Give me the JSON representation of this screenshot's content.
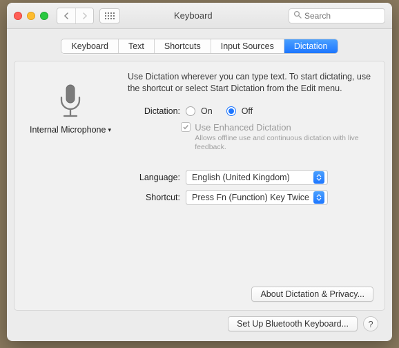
{
  "window": {
    "title": "Keyboard",
    "search_placeholder": "Search"
  },
  "tabs": {
    "keyboard": "Keyboard",
    "text": "Text",
    "shortcuts": "Shortcuts",
    "input_sources": "Input Sources",
    "dictation": "Dictation"
  },
  "mic": {
    "label": "Internal Microphone"
  },
  "dictation": {
    "intro": "Use Dictation wherever you can type text. To start dictating, use the shortcut or select Start Dictation from the Edit menu.",
    "label": "Dictation:",
    "on": "On",
    "off": "Off",
    "enhanced_label": "Use Enhanced Dictation",
    "enhanced_hint": "Allows offline use and continuous dictation with live feedback."
  },
  "language": {
    "label": "Language:",
    "value": "English (United Kingdom)"
  },
  "shortcut": {
    "label": "Shortcut:",
    "value": "Press Fn (Function) Key Twice"
  },
  "buttons": {
    "about": "About Dictation & Privacy...",
    "bluetooth": "Set Up Bluetooth Keyboard...",
    "help": "?"
  }
}
